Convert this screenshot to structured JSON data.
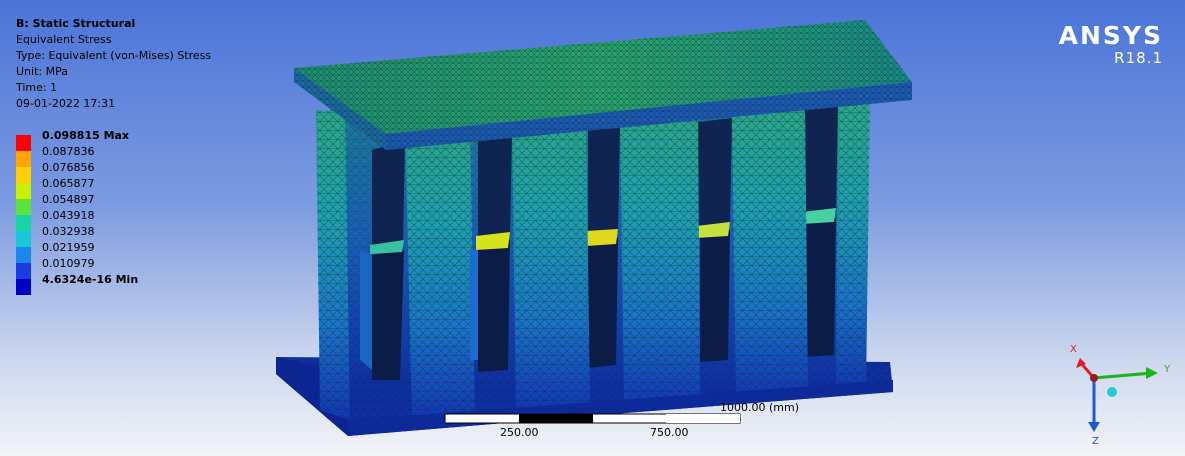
{
  "info": {
    "title": "B: Static Structural",
    "result": "Equivalent Stress",
    "type": "Type: Equivalent (von-Mises) Stress",
    "unit": "Unit: MPa",
    "time": "Time: 1",
    "date": "09-01-2022 17:31"
  },
  "legend": {
    "max_label": "0.098815 Max",
    "values": [
      "0.087836",
      "0.076856",
      "0.065877",
      "0.054897",
      "0.043918",
      "0.032938",
      "0.021959",
      "0.010979"
    ],
    "min_label": "4.6324e-16 Min",
    "colors": [
      "#ff0000",
      "#ffa500",
      "#ffd000",
      "#c8f000",
      "#5de23e",
      "#15d6a3",
      "#19c8d4",
      "#1c87e6",
      "#1a3be0",
      "#0000c8"
    ]
  },
  "brand": {
    "logo": "ANSYS",
    "version": "R18.1"
  },
  "scalebar": {
    "label_total": "1000.00 (mm)",
    "label_quarter": "250.00",
    "label_three_quarter": "750.00"
  },
  "triad": {
    "x_label": "X",
    "y_label": "Y",
    "z_label": "Z",
    "x_color": "#e02020",
    "y_color": "#1db31d",
    "z_color": "#1e5ad8"
  },
  "model": {
    "mesh_color": "#1f8f8a",
    "base_color": "#0d2aa8",
    "top_color": "#1e9a7a"
  }
}
